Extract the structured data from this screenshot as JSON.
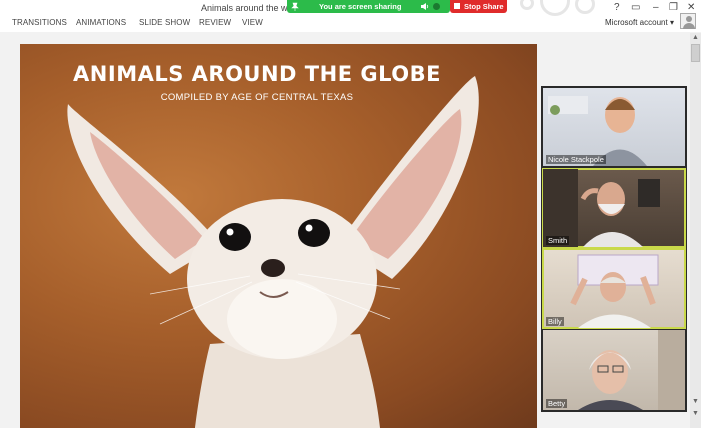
{
  "window": {
    "title": "Animals around the world",
    "controls": [
      "?",
      "▭",
      "–",
      "❐",
      "✕"
    ]
  },
  "ribbon": {
    "tabs": [
      "TRANSITIONS",
      "ANIMATIONS",
      "SLIDE SHOW",
      "REVIEW",
      "VIEW"
    ],
    "account_label": "Microsoft account",
    "account_caret": "▾"
  },
  "share": {
    "status": "You are screen sharing",
    "stop_label": "Stop Share",
    "bar_color": "#2cbb4a",
    "stop_color": "#e02b2b"
  },
  "slide": {
    "title": "ANIMALS AROUND THE GLOBE",
    "subtitle": "COMPILED BY AGE OF CENTRAL TEXAS"
  },
  "participants": [
    {
      "name": "Nicole Stackpole"
    },
    {
      "name": "Smith"
    },
    {
      "name": "Billy"
    },
    {
      "name": "Betty"
    }
  ],
  "active_speaker_color": "#c9d94a"
}
